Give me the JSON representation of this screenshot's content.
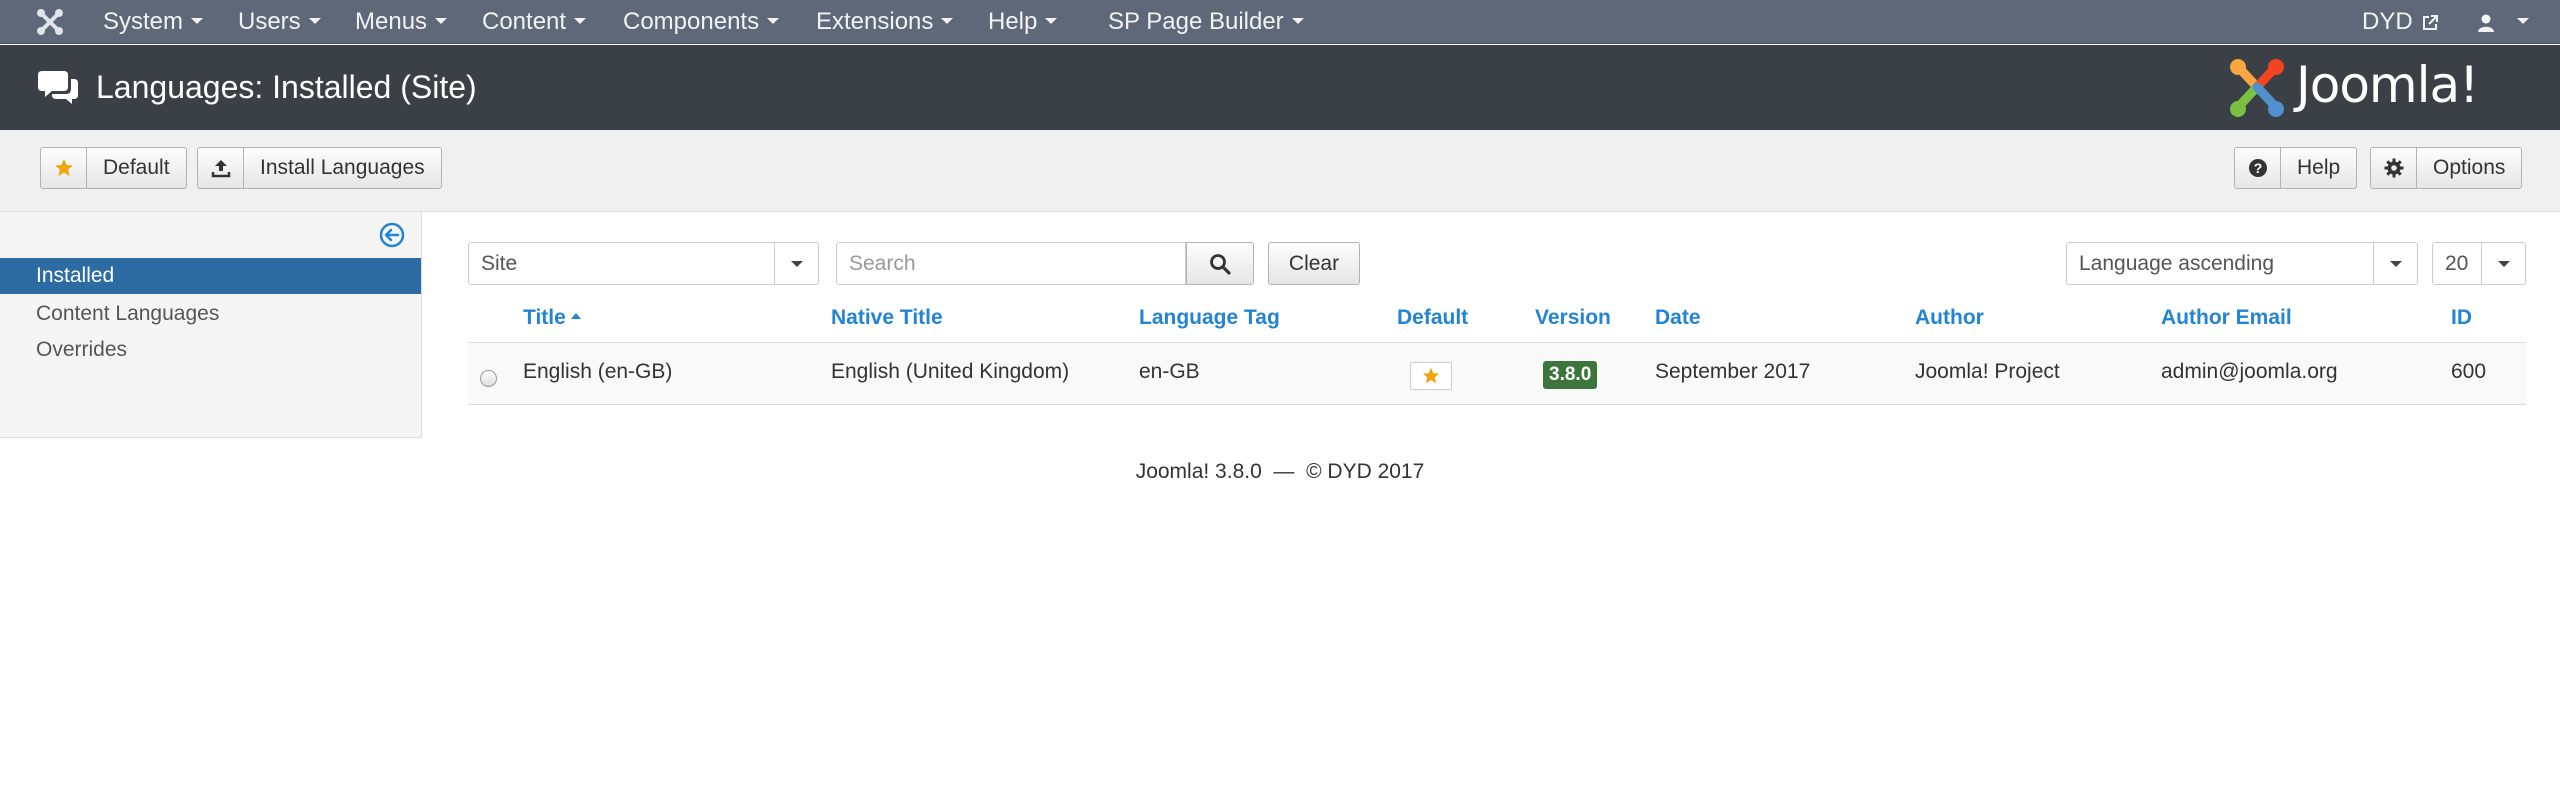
{
  "navbar": {
    "items": [
      {
        "label": "System"
      },
      {
        "label": "Users"
      },
      {
        "label": "Menus"
      },
      {
        "label": "Content"
      },
      {
        "label": "Components"
      },
      {
        "label": "Extensions"
      },
      {
        "label": "Help"
      },
      {
        "label": "SP Page Builder"
      }
    ],
    "site_link": "DYD",
    "user_icon": "user-icon"
  },
  "header": {
    "title": "Languages: Installed (Site)",
    "logo_text": "Joomla!",
    "icon": "comments-icon"
  },
  "toolbar": {
    "default_label": "Default",
    "install_label": "Install Languages",
    "help_label": "Help",
    "options_label": "Options"
  },
  "sidebar": {
    "items": [
      {
        "label": "Installed",
        "active": true
      },
      {
        "label": "Content Languages",
        "active": false
      },
      {
        "label": "Overrides",
        "active": false
      }
    ]
  },
  "filters": {
    "client_select": "Site",
    "search_placeholder": "Search",
    "clear_label": "Clear",
    "ordering_select": "Language ascending",
    "limit_select": "20"
  },
  "table": {
    "columns": [
      "Title",
      "Native Title",
      "Language Tag",
      "Default",
      "Version",
      "Date",
      "Author",
      "Author Email",
      "ID"
    ],
    "rows": [
      {
        "title": "English (en-GB)",
        "native_title": "English (United Kingdom)",
        "tag": "en-GB",
        "default": true,
        "version": "3.8.0",
        "date": "September 2017",
        "author": "Joomla! Project",
        "email": "admin@joomla.org",
        "id": "600"
      }
    ]
  },
  "footer": {
    "text": "Joomla! 3.8.0  —  © DYD 2017"
  },
  "colors": {
    "navbar": "#5e6879",
    "header": "#3b4046",
    "link": "#2384d3",
    "sidebar_active": "#2d6ca2",
    "version_badge": "#3c763d",
    "star": "#f0a30a"
  }
}
